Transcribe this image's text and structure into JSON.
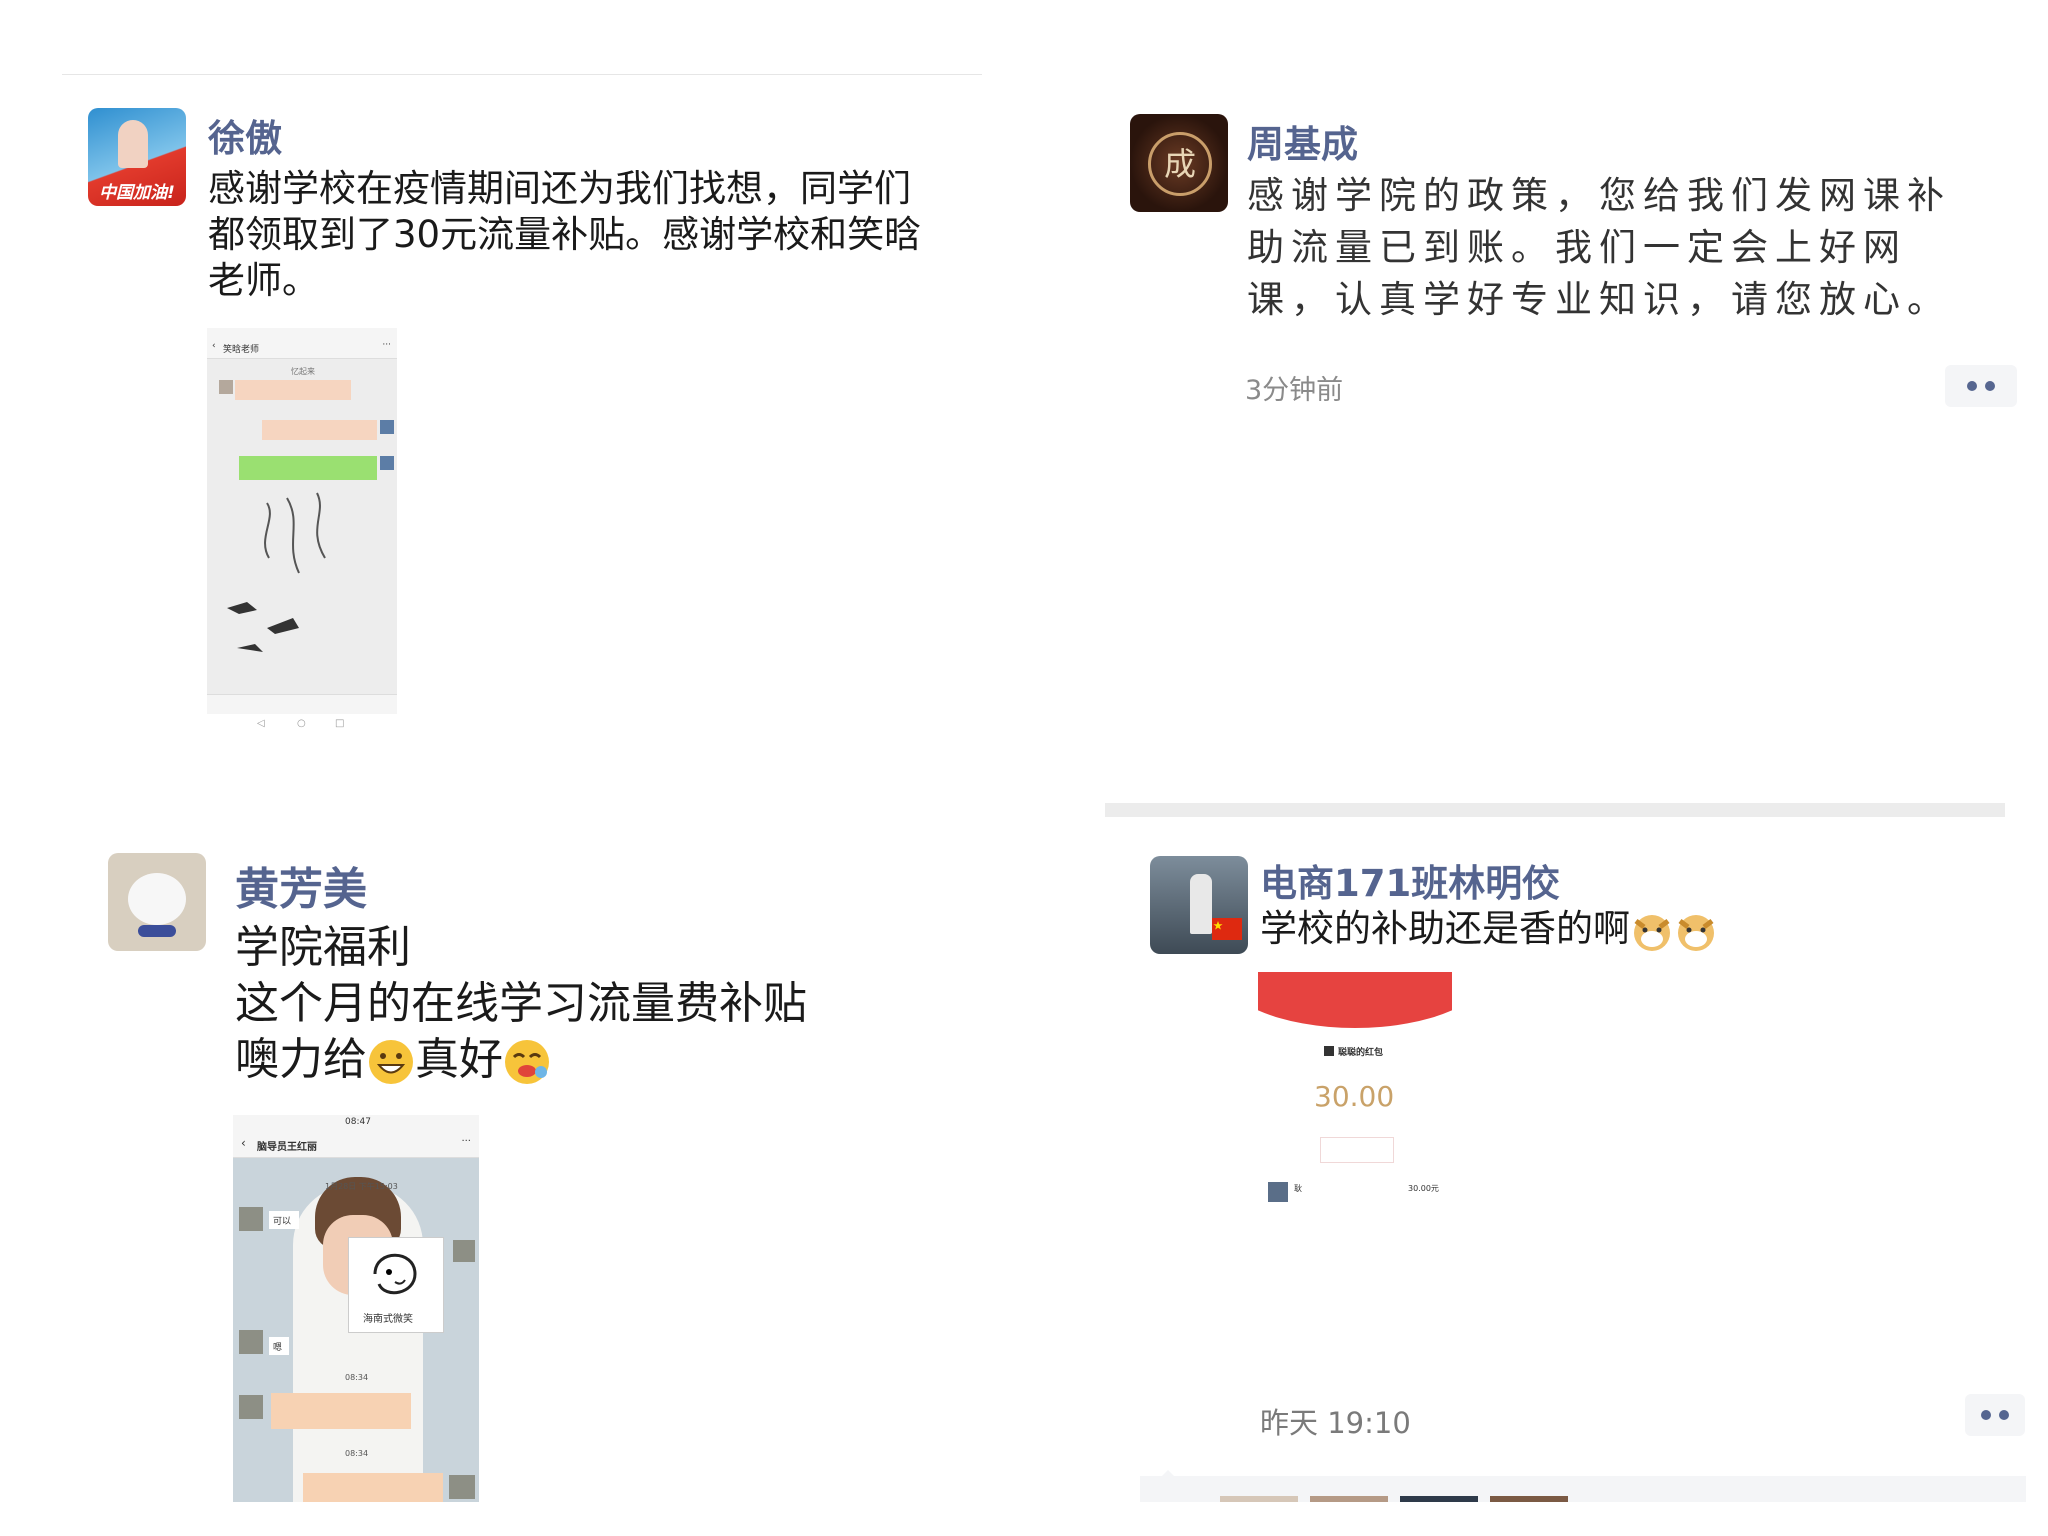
{
  "posts": [
    {
      "author": "徐傲",
      "avatar_text": "中国加油!",
      "text": "感谢学校在疫情期间还为我们找想，同学们都领取到了30元流量补贴。感谢学校和笑晗老师。",
      "image": {
        "contact": "笑晗老师",
        "stamp": "忆起来"
      }
    },
    {
      "author": "周基成",
      "avatar_text": "成",
      "text": "感谢学院的政策，您给我们发网课补助流量已到账。我们一定会上好网课，认真学好专业知识，请您放心。",
      "time": "3分钟前"
    },
    {
      "author": "黄芳美",
      "lines": [
        "学院福利",
        "这个月的在线学习流量费补贴",
        "噢力给",
        "真好"
      ],
      "image": {
        "time": "08:47",
        "contact": "脑导员王红丽",
        "date": "1月28日 下午15:03",
        "reply_1": "可以",
        "reply_2": "嗯",
        "time_2": "08:34",
        "time_3": "08:34",
        "sticker": "海南式微笑"
      }
    },
    {
      "author": "电商171班林明佼",
      "text": "学校的补助还是香的啊",
      "time": "昨天 19:10",
      "image": {
        "title": "聪聪的红包",
        "amount": "30.00",
        "row_name": "耿",
        "row_amount": "30.00元"
      }
    }
  ],
  "colors": {
    "name": "#55648f",
    "meta": "#8a8a8a",
    "red_packet": "#e64340",
    "amount": "#c9a269"
  },
  "icons": [
    "more-icon",
    "china-flag-icon",
    "grin-emoji",
    "laugh-emoji",
    "doge-emoji"
  ]
}
